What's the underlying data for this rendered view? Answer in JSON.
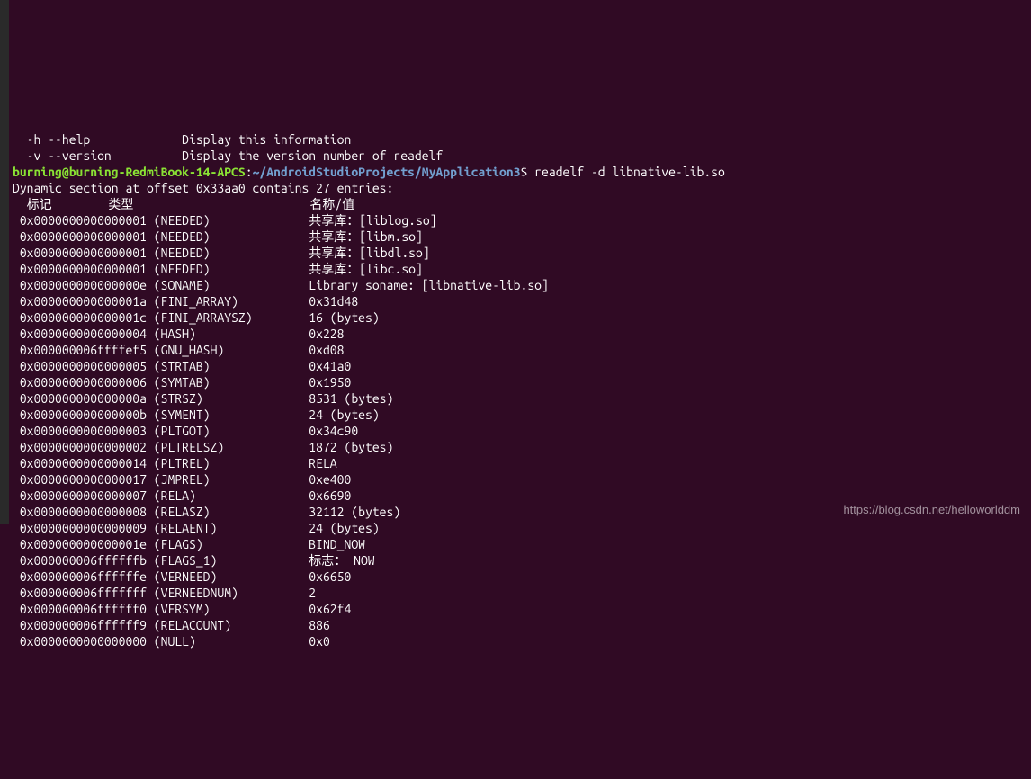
{
  "partial_top": [
    "  -h --help             Display this information",
    "  -v --version          Display the version number of readelf"
  ],
  "prompt": {
    "user_host": "burning@burning-RedmiBook-14-APCS",
    "colon": ":",
    "path": "~/AndroidStudioProjects/MyApplication3",
    "dollar": "$",
    "command": " readelf -d libnative-lib.so"
  },
  "blank": "",
  "section_header": "Dynamic section at offset 0x33aa0 contains 27 entries:",
  "columns": "  标记        类型                         名称/值",
  "entries": [
    {
      "tag": " 0x0000000000000001",
      "type": "(NEEDED)",
      "value": "共享库：[liblog.so]"
    },
    {
      "tag": " 0x0000000000000001",
      "type": "(NEEDED)",
      "value": "共享库：[libm.so]"
    },
    {
      "tag": " 0x0000000000000001",
      "type": "(NEEDED)",
      "value": "共享库：[libdl.so]"
    },
    {
      "tag": " 0x0000000000000001",
      "type": "(NEEDED)",
      "value": "共享库：[libc.so]"
    },
    {
      "tag": " 0x000000000000000e",
      "type": "(SONAME)",
      "value": "Library soname: [libnative-lib.so]"
    },
    {
      "tag": " 0x000000000000001a",
      "type": "(FINI_ARRAY)",
      "value": "0x31d48"
    },
    {
      "tag": " 0x000000000000001c",
      "type": "(FINI_ARRAYSZ)",
      "value": "16 (bytes)"
    },
    {
      "tag": " 0x0000000000000004",
      "type": "(HASH)",
      "value": "0x228"
    },
    {
      "tag": " 0x000000006ffffef5",
      "type": "(GNU_HASH)",
      "value": "0xd08"
    },
    {
      "tag": " 0x0000000000000005",
      "type": "(STRTAB)",
      "value": "0x41a0"
    },
    {
      "tag": " 0x0000000000000006",
      "type": "(SYMTAB)",
      "value": "0x1950"
    },
    {
      "tag": " 0x000000000000000a",
      "type": "(STRSZ)",
      "value": "8531 (bytes)"
    },
    {
      "tag": " 0x000000000000000b",
      "type": "(SYMENT)",
      "value": "24 (bytes)"
    },
    {
      "tag": " 0x0000000000000003",
      "type": "(PLTGOT)",
      "value": "0x34c90"
    },
    {
      "tag": " 0x0000000000000002",
      "type": "(PLTRELSZ)",
      "value": "1872 (bytes)"
    },
    {
      "tag": " 0x0000000000000014",
      "type": "(PLTREL)",
      "value": "RELA"
    },
    {
      "tag": " 0x0000000000000017",
      "type": "(JMPREL)",
      "value": "0xe400"
    },
    {
      "tag": " 0x0000000000000007",
      "type": "(RELA)",
      "value": "0x6690"
    },
    {
      "tag": " 0x0000000000000008",
      "type": "(RELASZ)",
      "value": "32112 (bytes)"
    },
    {
      "tag": " 0x0000000000000009",
      "type": "(RELAENT)",
      "value": "24 (bytes)"
    },
    {
      "tag": " 0x000000000000001e",
      "type": "(FLAGS)",
      "value": "BIND_NOW"
    },
    {
      "tag": " 0x000000006ffffffb",
      "type": "(FLAGS_1)",
      "value": "标志： NOW"
    },
    {
      "tag": " 0x000000006ffffffe",
      "type": "(VERNEED)",
      "value": "0x6650"
    },
    {
      "tag": " 0x000000006fffffff",
      "type": "(VERNEEDNUM)",
      "value": "2"
    },
    {
      "tag": " 0x000000006ffffff0",
      "type": "(VERSYM)",
      "value": "0x62f4"
    },
    {
      "tag": " 0x000000006ffffff9",
      "type": "(RELACOUNT)",
      "value": "886"
    },
    {
      "tag": " 0x0000000000000000",
      "type": "(NULL)",
      "value": "0x0"
    }
  ],
  "watermark": "https://blog.csdn.net/helloworlddm"
}
